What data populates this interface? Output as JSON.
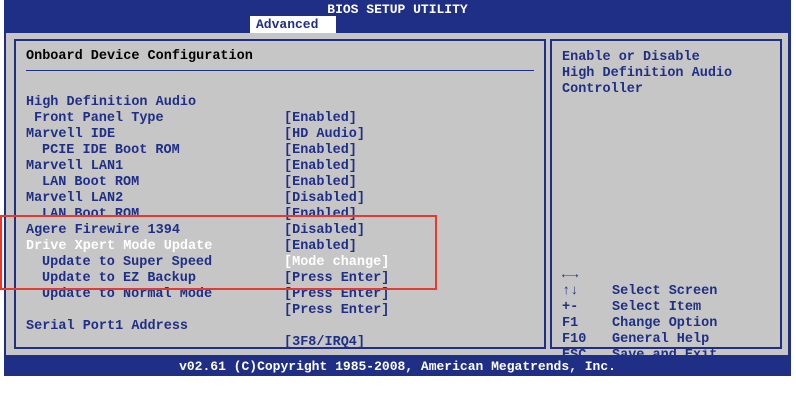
{
  "header": {
    "title": "BIOS SETUP UTILITY",
    "active_tab": "Advanced"
  },
  "panel": {
    "heading": "Onboard Device Configuration"
  },
  "settings": [
    {
      "label": "High Definition Audio",
      "value": "[Enabled]",
      "indent": 0
    },
    {
      "label": "Front Panel Type",
      "value": "[HD Audio]",
      "indent": 1
    },
    {
      "label": "Marvell IDE",
      "value": "[Enabled]",
      "indent": 0
    },
    {
      "label": "PCIE IDE Boot ROM",
      "value": "[Enabled]",
      "indent": 2
    },
    {
      "label": "Marvell LAN1",
      "value": "[Enabled]",
      "indent": 0
    },
    {
      "label": "LAN Boot ROM",
      "value": "[Disabled]",
      "indent": 2
    },
    {
      "label": "Marvell LAN2",
      "value": "[Enabled]",
      "indent": 0
    },
    {
      "label": "LAN Boot ROM",
      "value": "[Disabled]",
      "indent": 2
    },
    {
      "label": "Agere Firewire 1394",
      "value": "[Enabled]",
      "indent": 0
    },
    {
      "label": "Drive Xpert Mode Update",
      "value": "[Mode change]",
      "indent": 0,
      "highlighted": true
    },
    {
      "label": "Update to Super Speed",
      "value": "[Press Enter]",
      "indent": 2
    },
    {
      "label": "Update to EZ Backup",
      "value": "[Press Enter]",
      "indent": 2
    },
    {
      "label": "Update to Normal Mode",
      "value": "[Press Enter]",
      "indent": 2
    },
    {
      "label": "Serial Port1 Address",
      "value": "[3F8/IRQ4]",
      "indent": 0
    }
  ],
  "help": {
    "text": "Enable or Disable\nHigh Definition Audio\nController"
  },
  "keys": [
    {
      "key": "←→",
      "desc": "Select Screen"
    },
    {
      "key": "↑↓",
      "desc": "Select Item"
    },
    {
      "key": "+-",
      "desc": "Change Option"
    },
    {
      "key": "F1",
      "desc": "General Help"
    },
    {
      "key": "F10",
      "desc": "Save and Exit"
    },
    {
      "key": "ESC",
      "desc": "Exit"
    }
  ],
  "footer": {
    "copyright": "v02.61 (C)Copyright 1985-2008, American Megatrends, Inc."
  },
  "colors": {
    "bios_blue": "#1f2f86",
    "panel_gray": "#c6c6c6",
    "highlight_text": "#ffffff",
    "callout_red": "#e8392f"
  }
}
